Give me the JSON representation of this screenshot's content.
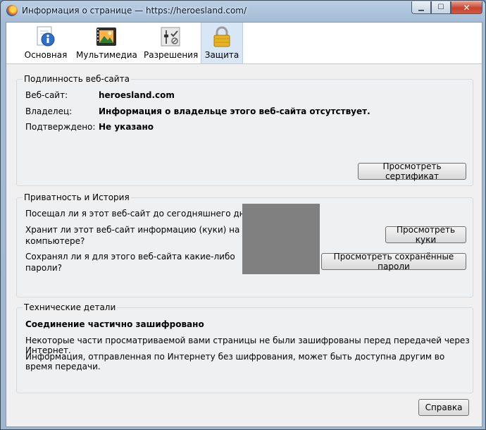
{
  "window": {
    "title": "Информация о странице — https://heroesland.com/",
    "controls": {
      "minimize": "▁",
      "maximize": "☐",
      "close": "✕"
    }
  },
  "tabs": [
    {
      "label": "Основная",
      "icon": "info-icon"
    },
    {
      "label": "Мультимедиа",
      "icon": "media-icon"
    },
    {
      "label": "Разрешения",
      "icon": "permissions-icon"
    },
    {
      "label": "Защита",
      "icon": "lock-icon",
      "selected": true
    }
  ],
  "identity": {
    "title": "Подлинность веб-сайта",
    "website_label": "Веб-сайт:",
    "website_value": "heroesland.com",
    "owner_label": "Владелец:",
    "owner_value": "Информация о владельце этого веб-сайта отсутствует.",
    "verified_label": "Подтверждено:",
    "verified_value": "Не указано",
    "view_cert_button": "Просмотреть сертификат"
  },
  "privacy": {
    "title": "Приватность и История",
    "visited_q": "Посещал ли я этот веб-сайт до сегодняшнего дня?",
    "cookies_q_line1": "Хранит ли этот веб-сайт информацию (куки) на моём",
    "cookies_q_line2": "компьютере?",
    "passwords_q_line1": "Сохранял ли я для этого веб-сайта какие-либо",
    "passwords_q_line2": "пароли?",
    "view_cookies_button": "Просмотреть куки",
    "view_passwords_button": "Просмотреть сохранённые пароли"
  },
  "technical": {
    "title": "Технические детали",
    "headline": "Соединение частично зашифровано",
    "line1": "Некоторые части просматриваемой вами страницы не были зашифрованы перед передачей через Интернет.",
    "line2": "Информация, отправленная по Интернету без шифрования, может быть доступна другим во время передачи."
  },
  "help_button": "Справка"
}
